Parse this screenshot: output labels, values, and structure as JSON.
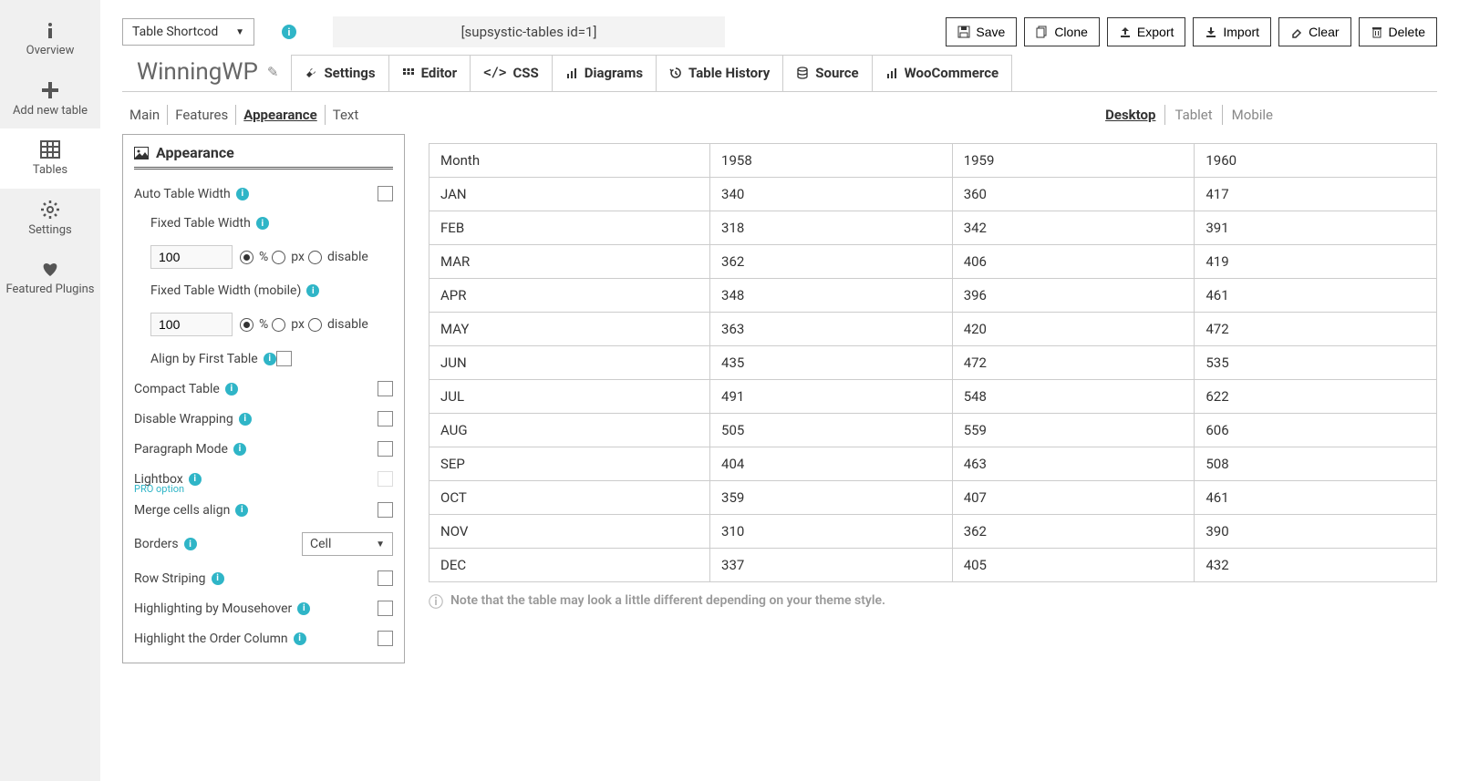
{
  "sidebar": [
    {
      "name": "overview",
      "label": "Overview",
      "icon": "info"
    },
    {
      "name": "add-new-table",
      "label": "Add new table",
      "icon": "plus"
    },
    {
      "name": "tables",
      "label": "Tables",
      "icon": "grid",
      "active": true
    },
    {
      "name": "settings",
      "label": "Settings",
      "icon": "gear"
    },
    {
      "name": "featured-plugins",
      "label": "Featured Plugins",
      "icon": "heart"
    }
  ],
  "top": {
    "shortcode_select_label": "Table Shortcod",
    "shortcode_text": "[supsystic-tables id=1]",
    "actions": [
      {
        "name": "save",
        "label": "Save",
        "icon": "save"
      },
      {
        "name": "clone",
        "label": "Clone",
        "icon": "copy"
      },
      {
        "name": "export",
        "label": "Export",
        "icon": "upload"
      },
      {
        "name": "import",
        "label": "Import",
        "icon": "download"
      },
      {
        "name": "clear",
        "label": "Clear",
        "icon": "eraser"
      },
      {
        "name": "delete",
        "label": "Delete",
        "icon": "trash"
      }
    ]
  },
  "title": "WinningWP",
  "main_tabs": [
    {
      "name": "settings",
      "label": "Settings",
      "icon": "wrench",
      "active": true
    },
    {
      "name": "editor",
      "label": "Editor",
      "icon": "dots"
    },
    {
      "name": "css",
      "label": "CSS",
      "icon": "code"
    },
    {
      "name": "diagrams",
      "label": "Diagrams",
      "icon": "bar"
    },
    {
      "name": "table-history",
      "label": "Table History",
      "icon": "history"
    },
    {
      "name": "source",
      "label": "Source",
      "icon": "db"
    },
    {
      "name": "woocommerce",
      "label": "WooCommerce",
      "icon": "bar"
    }
  ],
  "sub_tabs": [
    "Main",
    "Features",
    "Appearance",
    "Text"
  ],
  "sub_tab_active": "Appearance",
  "view_tabs": [
    "Desktop",
    "Tablet",
    "Mobile"
  ],
  "view_tab_active": "Desktop",
  "appearance": {
    "heading": "Appearance",
    "auto_table_width": "Auto Table Width",
    "fixed_table_width": "Fixed Table Width",
    "fixed_table_width_value": "100",
    "fixed_table_width_mobile": "Fixed Table Width (mobile)",
    "fixed_table_width_mobile_value": "100",
    "unit_percent": "%",
    "unit_px": "px",
    "unit_disable": "disable",
    "align_first": "Align by First Table",
    "compact": "Compact Table",
    "disable_wrap": "Disable Wrapping",
    "paragraph": "Paragraph Mode",
    "lightbox": "Lightbox",
    "pro_option": "PRO option",
    "merge_cells": "Merge cells align",
    "borders": "Borders",
    "borders_value": "Cell",
    "row_striping": "Row Striping",
    "highlight_hover": "Highlighting by Mousehover",
    "highlight_order": "Highlight the Order Column"
  },
  "preview": {
    "headers": [
      "Month",
      "1958",
      "1959",
      "1960"
    ],
    "rows": [
      [
        "JAN",
        "340",
        "360",
        "417"
      ],
      [
        "FEB",
        "318",
        "342",
        "391"
      ],
      [
        "MAR",
        "362",
        "406",
        "419"
      ],
      [
        "APR",
        "348",
        "396",
        "461"
      ],
      [
        "MAY",
        "363",
        "420",
        "472"
      ],
      [
        "JUN",
        "435",
        "472",
        "535"
      ],
      [
        "JUL",
        "491",
        "548",
        "622"
      ],
      [
        "AUG",
        "505",
        "559",
        "606"
      ],
      [
        "SEP",
        "404",
        "463",
        "508"
      ],
      [
        "OCT",
        "359",
        "407",
        "461"
      ],
      [
        "NOV",
        "310",
        "362",
        "390"
      ],
      [
        "DEC",
        "337",
        "405",
        "432"
      ]
    ],
    "note": "Note that the table may look a little different depending on your theme style."
  },
  "chart_data": {
    "type": "table",
    "title": "WinningWP",
    "categories": [
      "JAN",
      "FEB",
      "MAR",
      "APR",
      "MAY",
      "JUN",
      "JUL",
      "AUG",
      "SEP",
      "OCT",
      "NOV",
      "DEC"
    ],
    "series": [
      {
        "name": "1958",
        "values": [
          340,
          318,
          362,
          348,
          363,
          435,
          491,
          505,
          404,
          359,
          310,
          337
        ]
      },
      {
        "name": "1959",
        "values": [
          360,
          342,
          406,
          396,
          420,
          472,
          548,
          559,
          463,
          407,
          362,
          405
        ]
      },
      {
        "name": "1960",
        "values": [
          417,
          391,
          419,
          461,
          472,
          535,
          622,
          606,
          508,
          461,
          390,
          432
        ]
      }
    ],
    "xlabel": "Month",
    "ylabel": ""
  }
}
